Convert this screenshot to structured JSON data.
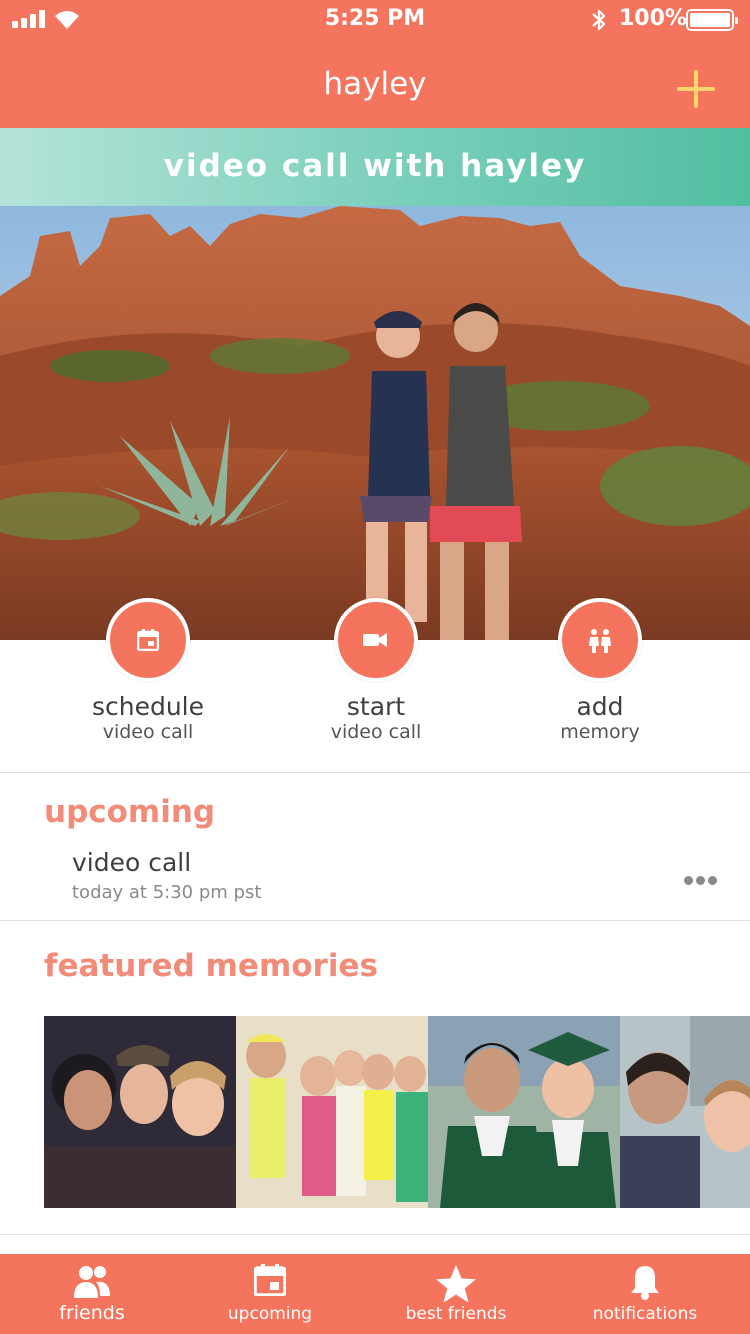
{
  "status_bar": {
    "time": "5:25 PM",
    "battery": "100%"
  },
  "nav": {
    "title": "hayley",
    "add_icon": "plus-icon"
  },
  "banner": {
    "text": "video call with hayley"
  },
  "actions": [
    {
      "title": "schedule",
      "subtitle": "video call",
      "icon": "calendar-icon"
    },
    {
      "title": "start",
      "subtitle": "video call",
      "icon": "video-camera-icon"
    },
    {
      "title": "add",
      "subtitle": "memory",
      "icon": "people-icon"
    }
  ],
  "upcoming": {
    "heading": "upcoming",
    "event": {
      "title": "video call",
      "time": "today at 5:30 pm pst"
    }
  },
  "featured": {
    "heading": "featured memories"
  },
  "tabs": [
    {
      "label": "friends",
      "icon": "friends-icon"
    },
    {
      "label": "upcoming",
      "icon": "calendar-icon"
    },
    {
      "label": "best friends",
      "icon": "star-icon"
    },
    {
      "label": "notifications",
      "icon": "bell-icon"
    }
  ],
  "colors": {
    "primary": "#f4745d",
    "accent": "#ffd66e",
    "section_title": "#f28c78",
    "banner_start": "#b5e3d9",
    "banner_end": "#52bea0"
  }
}
